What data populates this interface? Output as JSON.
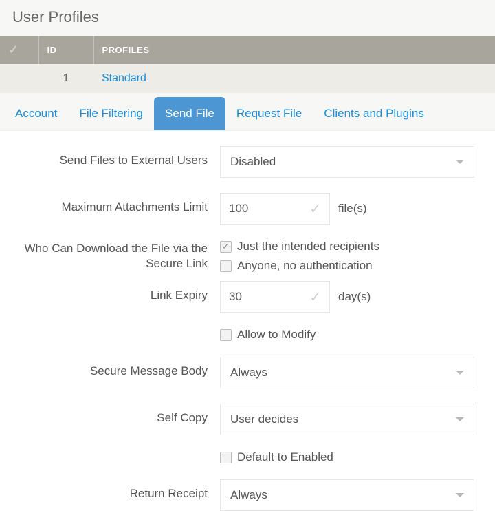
{
  "page_title": "User Profiles",
  "table": {
    "headers": {
      "id": "ID",
      "profiles": "PROFILES"
    },
    "rows": [
      {
        "id": "1",
        "profile": "Standard"
      }
    ]
  },
  "tabs": {
    "account": "Account",
    "file_filtering": "File Filtering",
    "send_file": "Send File",
    "request_file": "Request File",
    "clients_plugins": "Clients and Plugins"
  },
  "form": {
    "send_external": {
      "label": "Send Files to External Users",
      "value": "Disabled"
    },
    "max_attachments": {
      "label": "Maximum Attachments Limit",
      "value": "100",
      "suffix": "file(s)"
    },
    "who_download": {
      "label": "Who Can Download the File via the Secure Link",
      "opt_intended": "Just the intended recipients",
      "opt_anyone": "Anyone, no authentication"
    },
    "link_expiry": {
      "label": "Link Expiry",
      "value": "30",
      "suffix": "day(s)"
    },
    "allow_modify": {
      "label": "Allow to Modify"
    },
    "secure_body": {
      "label": "Secure Message Body",
      "value": "Always"
    },
    "self_copy": {
      "label": "Self Copy",
      "value": "User decides"
    },
    "default_enabled": {
      "label": "Default to Enabled"
    },
    "return_receipt": {
      "label": "Return Receipt",
      "value": "Always"
    }
  }
}
